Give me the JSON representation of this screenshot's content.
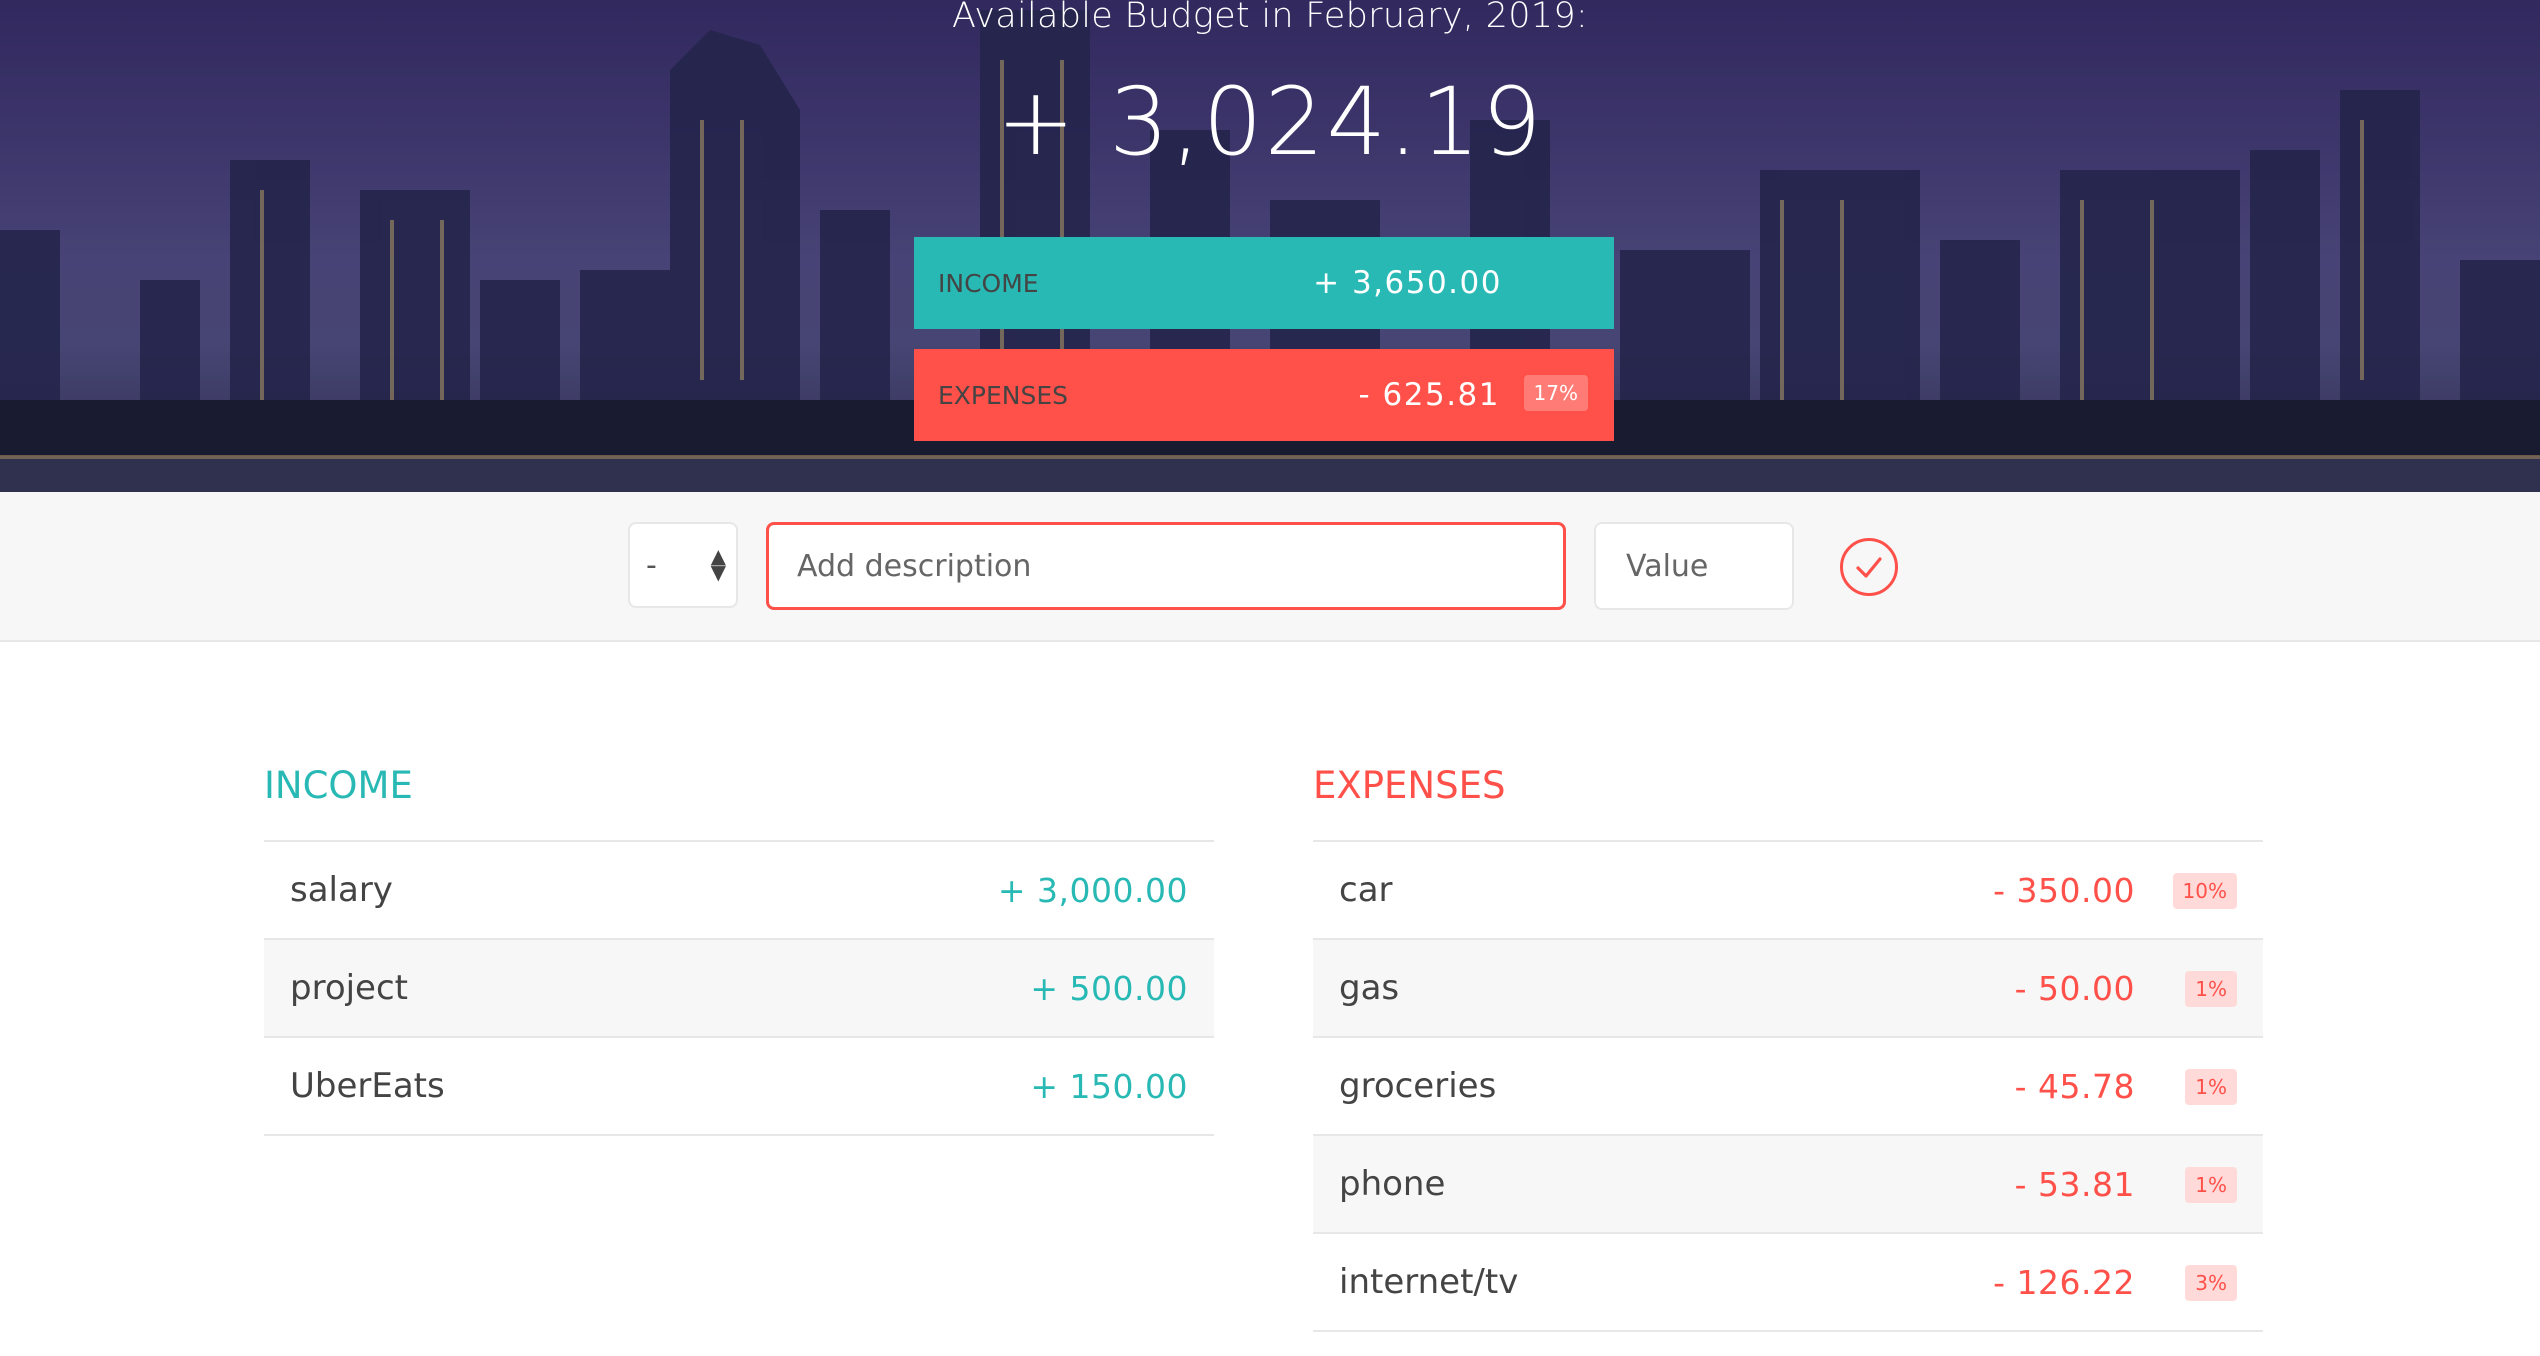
{
  "header": {
    "budget_title": "Available Budget in February, 2019:",
    "budget_value": "+ 3,024.19",
    "income_label": "Income",
    "income_value": "+ 3,650.00",
    "expenses_label": "Expenses",
    "expenses_value": "- 625.81",
    "expenses_percentage": "17%"
  },
  "add_form": {
    "type_value": "-",
    "description_placeholder": "Add description",
    "value_placeholder": "Value",
    "submit_icon": "checkmark-circle-icon"
  },
  "income": {
    "title": "Income",
    "items": [
      {
        "description": "salary",
        "value": "+ 3,000.00"
      },
      {
        "description": "project",
        "value": "+ 500.00"
      },
      {
        "description": "UberEats",
        "value": "+ 150.00"
      }
    ]
  },
  "expenses": {
    "title": "Expenses",
    "items": [
      {
        "description": "car",
        "value": "- 350.00",
        "percentage": "10%"
      },
      {
        "description": "gas",
        "value": "- 50.00",
        "percentage": "1%"
      },
      {
        "description": "groceries",
        "value": "- 45.78",
        "percentage": "1%"
      },
      {
        "description": "phone",
        "value": "- 53.81",
        "percentage": "1%"
      },
      {
        "description": "internet/tv",
        "value": "- 126.22",
        "percentage": "3%"
      }
    ]
  },
  "colors": {
    "income": "#28b9b5",
    "expenses": "#ff5049"
  }
}
